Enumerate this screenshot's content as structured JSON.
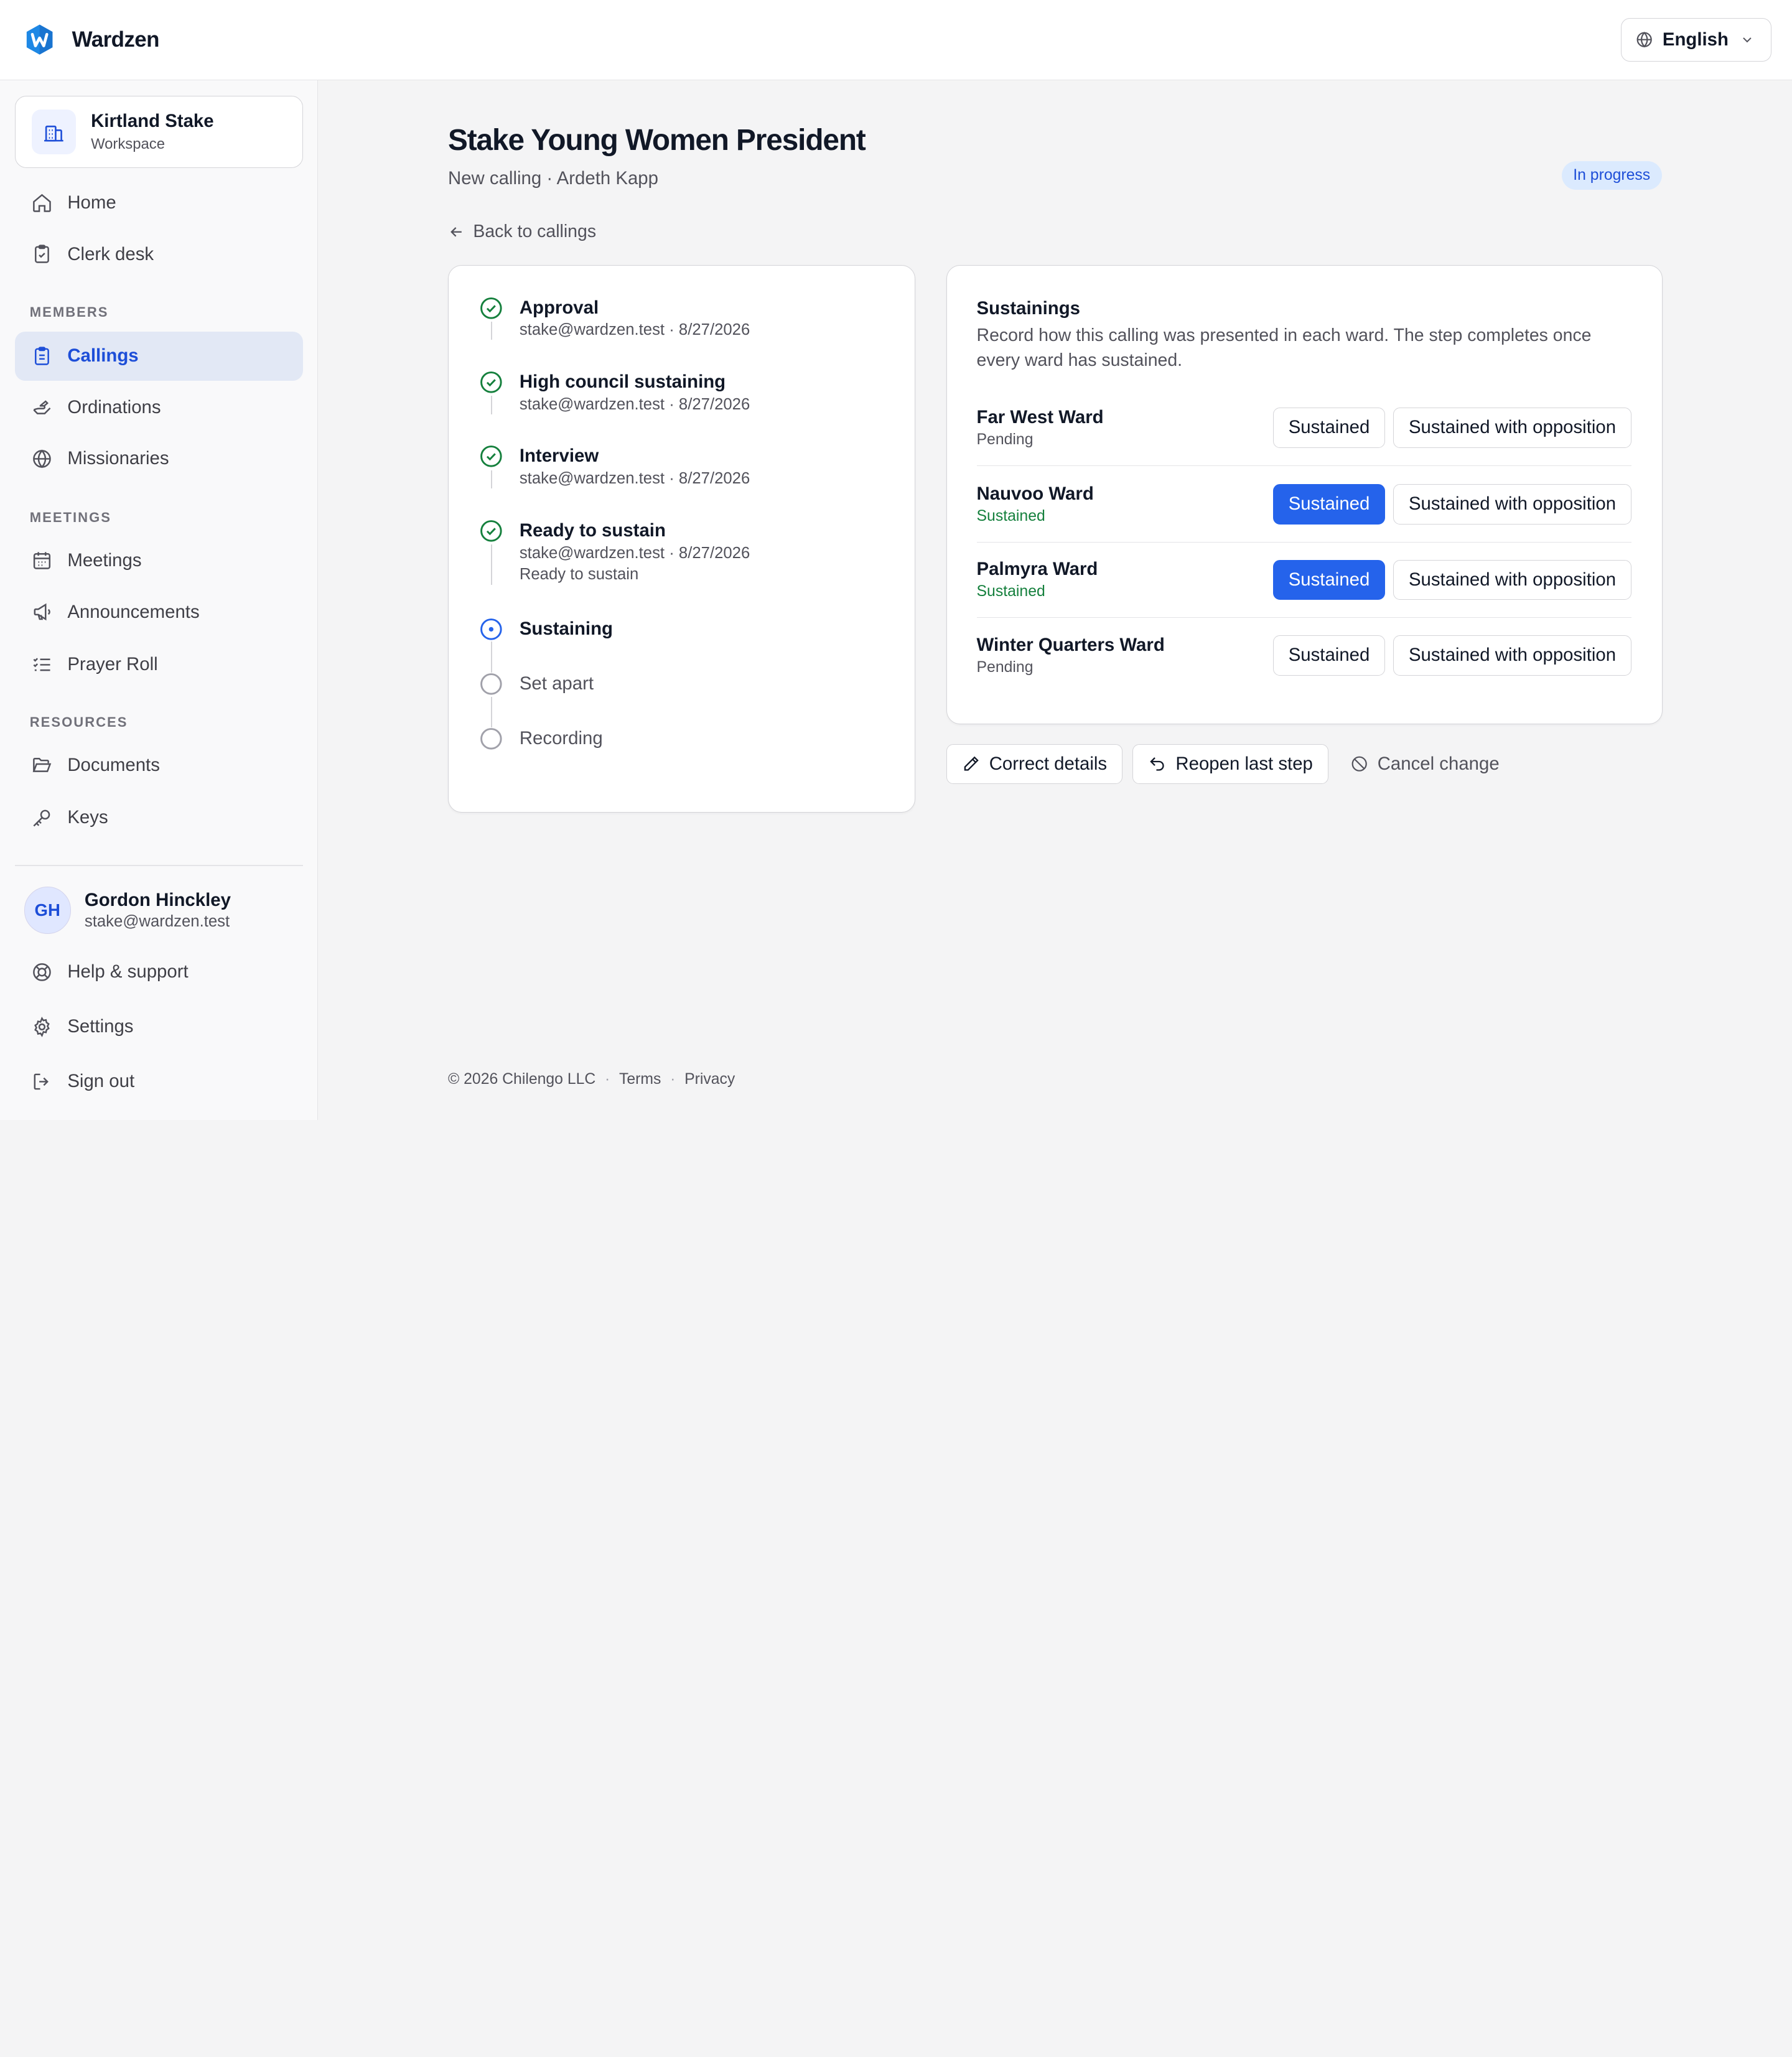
{
  "app": {
    "name": "Wardzen"
  },
  "header": {
    "language": "English"
  },
  "workspace": {
    "name": "Kirtland Stake",
    "type": "Workspace"
  },
  "nav": {
    "home": "Home",
    "clerk_desk": "Clerk desk",
    "members_section": "MEMBERS",
    "callings": "Callings",
    "ordinations": "Ordinations",
    "missionaries": "Missionaries",
    "meetings_section": "MEETINGS",
    "meetings": "Meetings",
    "announcements": "Announcements",
    "prayer_roll": "Prayer Roll",
    "resources_section": "RESOURCES",
    "documents": "Documents",
    "keys": "Keys",
    "help": "Help & support",
    "settings": "Settings",
    "sign_out": "Sign out"
  },
  "user": {
    "initials": "GH",
    "name": "Gordon Hinckley",
    "email": "stake@wardzen.test"
  },
  "page": {
    "title": "Stake Young Women President",
    "subtitle": "New calling · Ardeth Kapp",
    "status": "In progress",
    "back": "Back to callings"
  },
  "steps": [
    {
      "title": "Approval",
      "meta": "stake@wardzen.test · 8/27/2026",
      "state": "done"
    },
    {
      "title": "High council sustaining",
      "meta": "stake@wardzen.test · 8/27/2026",
      "state": "done"
    },
    {
      "title": "Interview",
      "meta": "stake@wardzen.test · 8/27/2026",
      "state": "done"
    },
    {
      "title": "Ready to sustain",
      "meta": "stake@wardzen.test · 8/27/2026",
      "note": "Ready to sustain",
      "state": "done"
    },
    {
      "title": "Sustaining",
      "state": "current"
    },
    {
      "title": "Set apart",
      "state": "pending"
    },
    {
      "title": "Recording",
      "state": "pending"
    }
  ],
  "sustainings": {
    "title": "Sustainings",
    "description": "Record how this calling was presented in each ward. The step completes once every ward has sustained.",
    "sustained_label": "Sustained",
    "opposition_label": "Sustained with opposition",
    "wards": [
      {
        "name": "Far West Ward",
        "status": "Pending"
      },
      {
        "name": "Nauvoo Ward",
        "status": "Sustained"
      },
      {
        "name": "Palmyra Ward",
        "status": "Sustained"
      },
      {
        "name": "Winter Quarters Ward",
        "status": "Pending"
      }
    ]
  },
  "actions": {
    "correct": "Correct details",
    "reopen": "Reopen last step",
    "cancel": "Cancel change"
  },
  "footer": {
    "copyright": "© 2026 Chilengo LLC",
    "terms": "Terms",
    "privacy": "Privacy"
  },
  "colors": {
    "accent": "#2563eb",
    "success": "#15803d",
    "badge_bg": "#dbeafe"
  }
}
